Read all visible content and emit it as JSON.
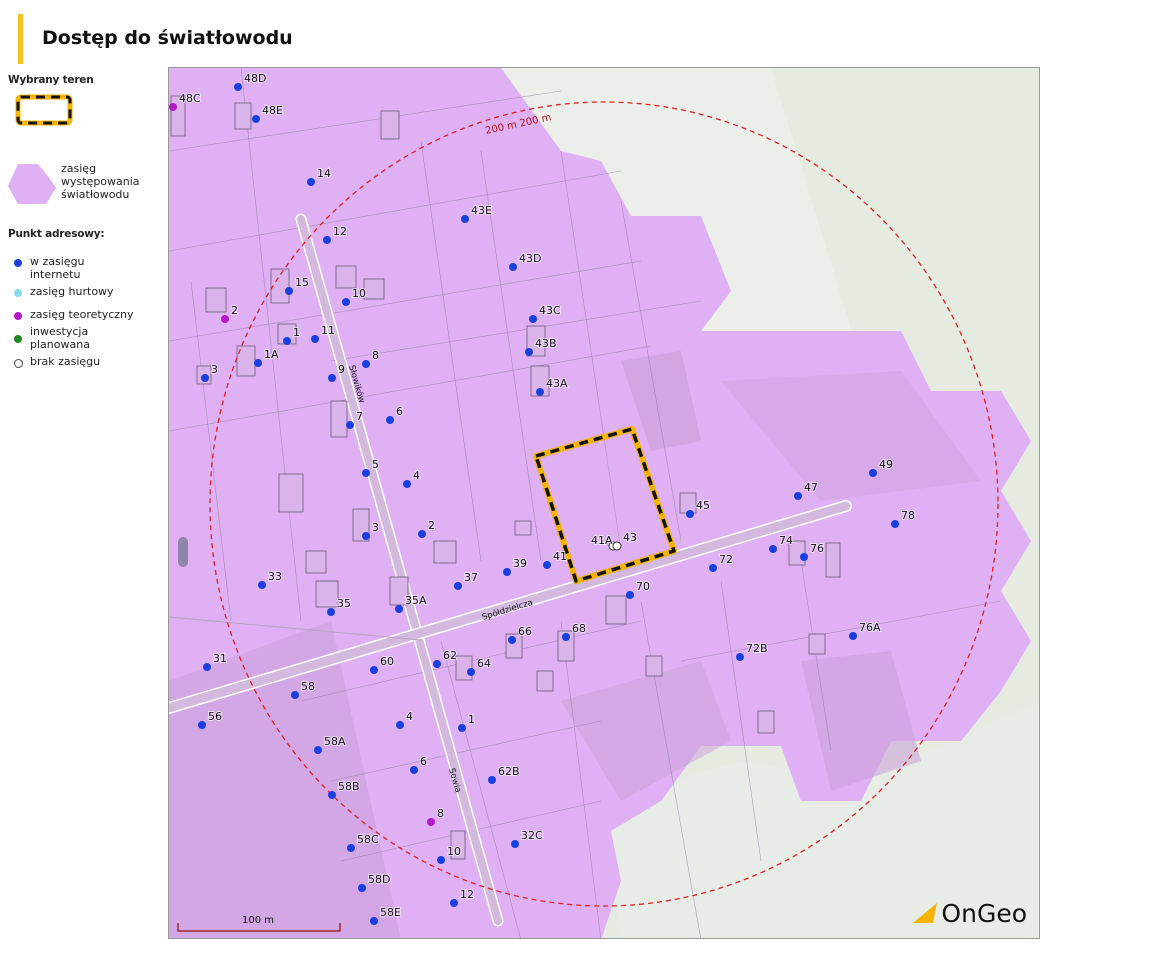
{
  "title": "Dostęp do światłowodu",
  "legend": {
    "selected_title": "Wybrany teren",
    "coverage_label": "zasięg występowania światłowodu",
    "address_title": "Punkt adresowy:",
    "items": [
      {
        "label": "w zasięgu internetu",
        "color": "#1a3fe0"
      },
      {
        "label": "zasięg hurtowy",
        "color": "#88d8ee"
      },
      {
        "label": "zasięg teoretyczny",
        "color": "#b319c9"
      },
      {
        "label": "inwestycja planowana",
        "color": "#1d8a1d"
      },
      {
        "label": "brak zasięgu",
        "color": "#ffffff"
      }
    ]
  },
  "map": {
    "radius_label": "200 m 200 m",
    "streets": [
      "Słowików",
      "Spółdzielcza",
      "Sowia"
    ],
    "scale_label": "100 m",
    "logo": "OnGeo",
    "colors": {
      "coverage": "#dfb0f3",
      "buffer": "#e02020",
      "selection": "#f4b400"
    },
    "points": [
      {
        "label": "48D",
        "type": "internet"
      },
      {
        "label": "48C",
        "type": "theoretical"
      },
      {
        "label": "48E",
        "type": "internet"
      },
      {
        "label": "14",
        "type": "internet"
      },
      {
        "label": "12",
        "type": "internet"
      },
      {
        "label": "43E",
        "type": "internet"
      },
      {
        "label": "43D",
        "type": "internet"
      },
      {
        "label": "15",
        "type": "internet"
      },
      {
        "label": "10",
        "type": "internet"
      },
      {
        "label": "2",
        "type": "theoretical"
      },
      {
        "label": "43C",
        "type": "internet"
      },
      {
        "label": "1",
        "type": "internet"
      },
      {
        "label": "11",
        "type": "internet"
      },
      {
        "label": "43B",
        "type": "internet"
      },
      {
        "label": "1A",
        "type": "internet"
      },
      {
        "label": "8",
        "type": "internet"
      },
      {
        "label": "3",
        "type": "internet"
      },
      {
        "label": "9",
        "type": "internet"
      },
      {
        "label": "43A",
        "type": "internet"
      },
      {
        "label": "6",
        "type": "internet"
      },
      {
        "label": "7",
        "type": "internet"
      },
      {
        "label": "49",
        "type": "internet"
      },
      {
        "label": "5",
        "type": "internet"
      },
      {
        "label": "4",
        "type": "internet"
      },
      {
        "label": "47",
        "type": "internet"
      },
      {
        "label": "45",
        "type": "internet"
      },
      {
        "label": "78",
        "type": "internet"
      },
      {
        "label": "3",
        "type": "internet"
      },
      {
        "label": "2",
        "type": "internet"
      },
      {
        "label": "41A",
        "type": "none"
      },
      {
        "label": "43",
        "type": "none"
      },
      {
        "label": "74",
        "type": "internet"
      },
      {
        "label": "76",
        "type": "internet"
      },
      {
        "label": "72",
        "type": "internet"
      },
      {
        "label": "41",
        "type": "internet"
      },
      {
        "label": "39",
        "type": "internet"
      },
      {
        "label": "37",
        "type": "internet"
      },
      {
        "label": "33",
        "type": "internet"
      },
      {
        "label": "70",
        "type": "internet"
      },
      {
        "label": "35A",
        "type": "internet"
      },
      {
        "label": "35",
        "type": "internet"
      },
      {
        "label": "68",
        "type": "internet"
      },
      {
        "label": "66",
        "type": "internet"
      },
      {
        "label": "76A",
        "type": "internet"
      },
      {
        "label": "72B",
        "type": "internet"
      },
      {
        "label": "31",
        "type": "internet"
      },
      {
        "label": "62",
        "type": "internet"
      },
      {
        "label": "60",
        "type": "internet"
      },
      {
        "label": "64",
        "type": "internet"
      },
      {
        "label": "58",
        "type": "internet"
      },
      {
        "label": "56",
        "type": "internet"
      },
      {
        "label": "4",
        "type": "internet"
      },
      {
        "label": "1",
        "type": "internet"
      },
      {
        "label": "58A",
        "type": "internet"
      },
      {
        "label": "6",
        "type": "internet"
      },
      {
        "label": "62B",
        "type": "internet"
      },
      {
        "label": "58B",
        "type": "internet"
      },
      {
        "label": "8",
        "type": "theoretical"
      },
      {
        "label": "32C",
        "type": "internet"
      },
      {
        "label": "58C",
        "type": "internet"
      },
      {
        "label": "10",
        "type": "internet"
      },
      {
        "label": "58D",
        "type": "internet"
      },
      {
        "label": "12",
        "type": "internet"
      },
      {
        "label": "58E",
        "type": "internet"
      }
    ]
  }
}
